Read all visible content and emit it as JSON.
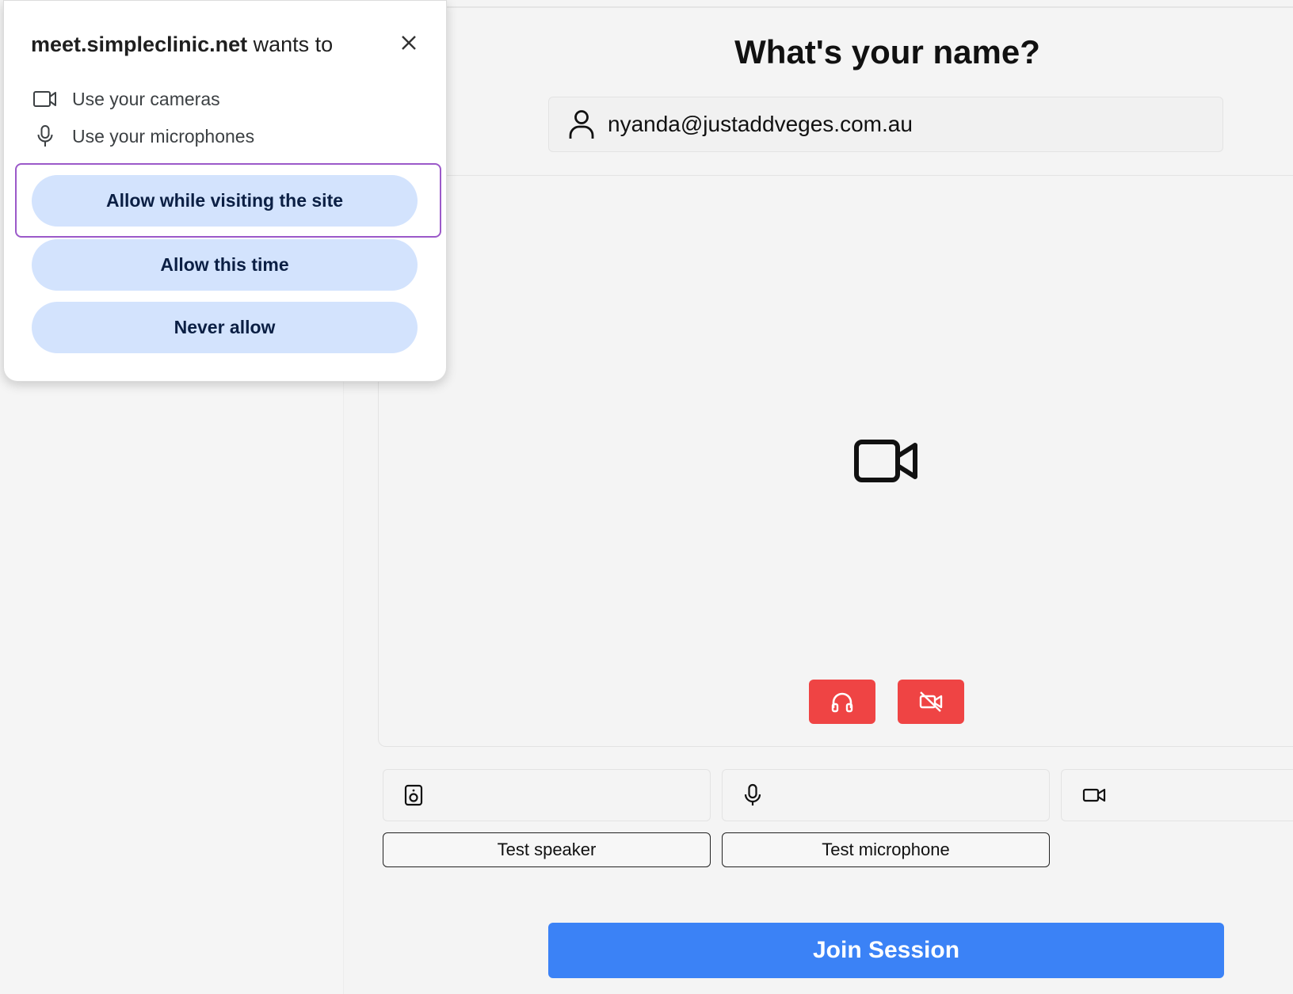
{
  "permission_prompt": {
    "site": "meet.simpleclinic.net",
    "title_suffix": "wants to",
    "permissions": [
      {
        "icon": "camera-icon",
        "label": "Use your cameras"
      },
      {
        "icon": "microphone-icon",
        "label": "Use your microphones"
      }
    ],
    "buttons": {
      "allow_while_visiting": "Allow while visiting the site",
      "allow_this_time": "Allow this time",
      "never_allow": "Never allow"
    },
    "close_icon": "close-icon",
    "focus_color": "#9b59c9"
  },
  "join": {
    "title": "What's your name?",
    "name_value": "nyanda@justaddveges.com.au",
    "person_icon": "person-icon",
    "video_placeholder_icon": "video-camera-icon",
    "controls": [
      {
        "icon": "headphones-icon"
      },
      {
        "icon": "video-off-icon"
      }
    ],
    "control_color": "#ef4444",
    "devices": [
      {
        "icon": "speaker-icon"
      },
      {
        "icon": "microphone-icon"
      },
      {
        "icon": "camera-icon"
      }
    ],
    "test_speaker": "Test speaker",
    "test_microphone": "Test microphone",
    "join_button": "Join Session",
    "join_color": "#3b82f6"
  }
}
